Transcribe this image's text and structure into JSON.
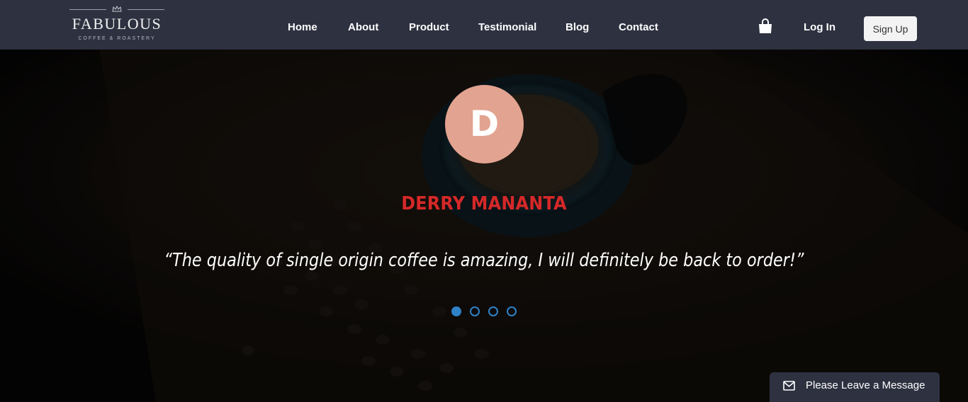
{
  "header": {
    "logo": {
      "name": "FABULOUS",
      "tagline": "COFFEE & ROASTERY"
    },
    "nav": [
      {
        "label": "Home"
      },
      {
        "label": "About"
      },
      {
        "label": "Product"
      },
      {
        "label": "Testimonial"
      },
      {
        "label": "Blog"
      },
      {
        "label": "Contact"
      }
    ],
    "cart_icon": "shopping-bag-icon",
    "login_label": "Log In",
    "signup_label": "Sign Up"
  },
  "testimonial": {
    "avatar_initial": "D",
    "avatar_color": "#e2a390",
    "name": "DERRY MANANTA",
    "name_color": "#d62828",
    "quote": "“The quality of single origin coffee is amazing, I will definitely be back to order!”",
    "slide_count": 4,
    "active_slide": 1,
    "dot_color": "#2f82c8"
  },
  "chat_widget": {
    "icon": "envelope-icon",
    "label": "Please Leave a Message"
  },
  "colors": {
    "header_bg": "#2e3140",
    "hero_bg": "#050505"
  }
}
